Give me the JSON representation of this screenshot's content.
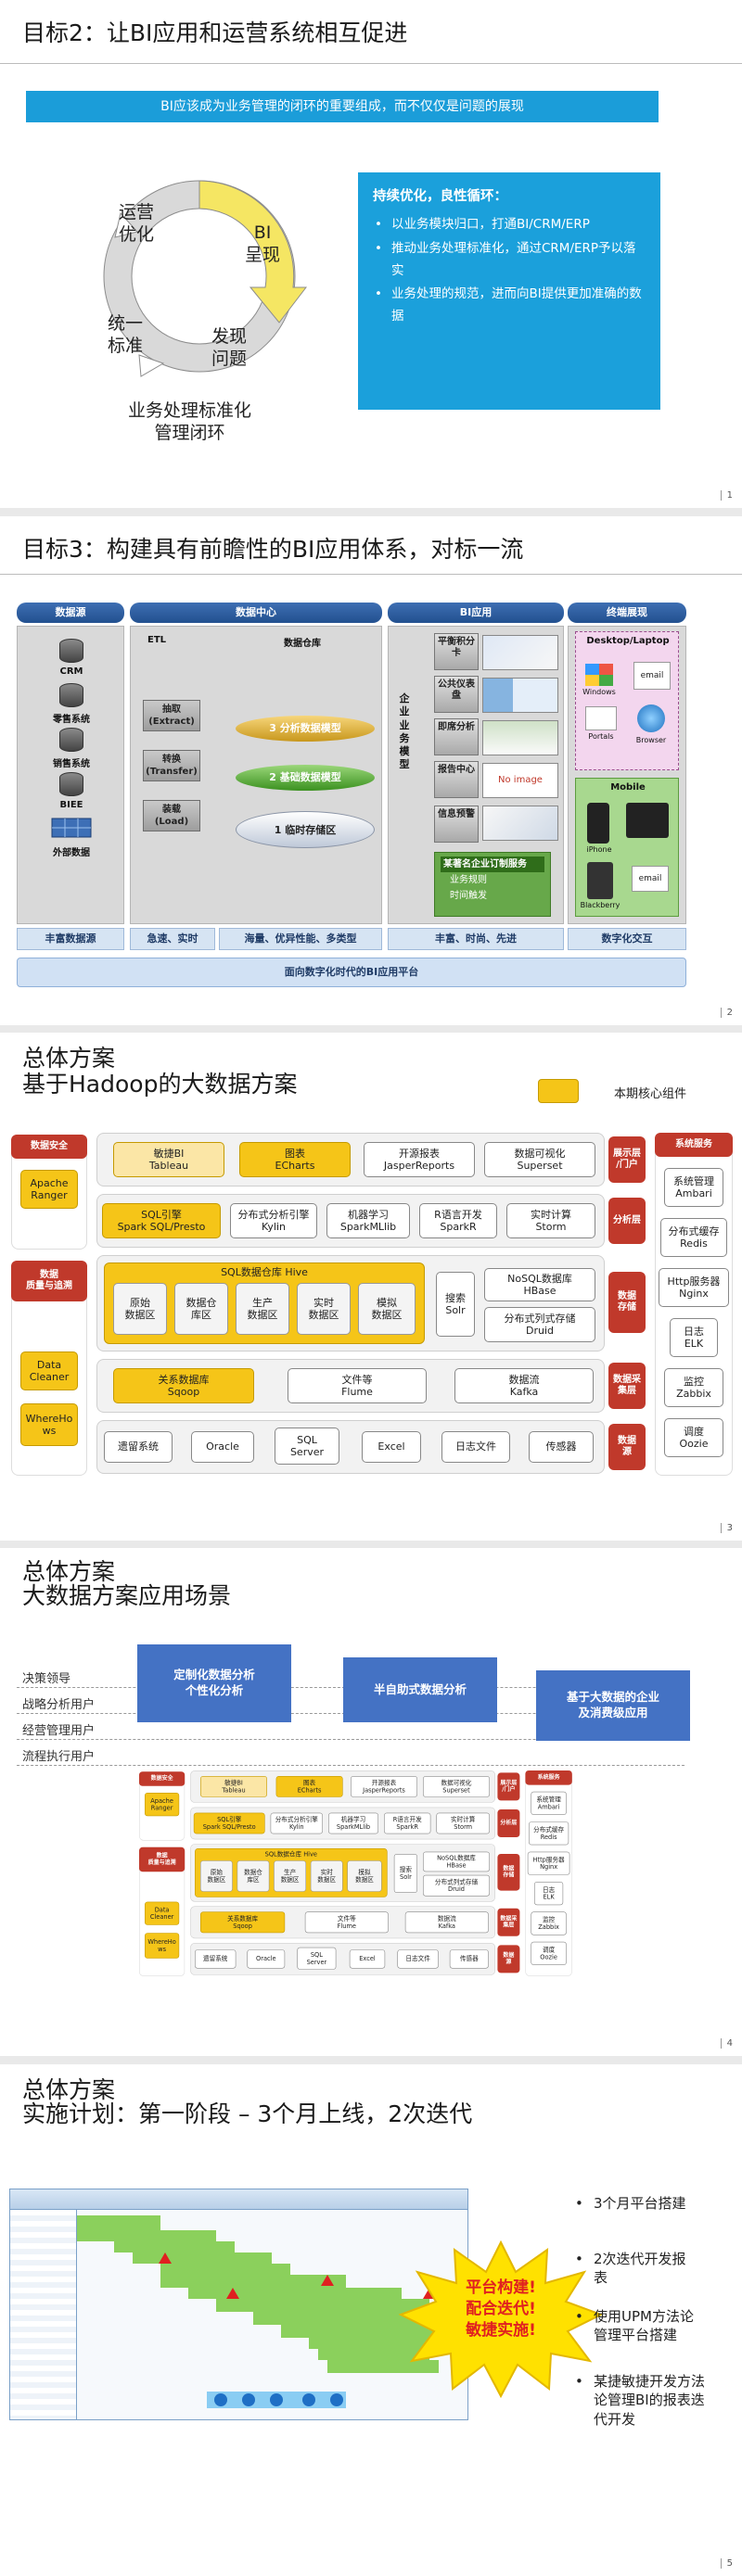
{
  "slide1": {
    "title": "目标2：让BI应用和运营系统相互促进",
    "banner": "BI应该成为业务管理的闭环的重要组成，而不仅仅是问题的展现",
    "cycle": {
      "ops": "运营\n优化",
      "bi": "BI\n呈现",
      "find": "发现\n问题",
      "std": "统一\n标准",
      "bottom": "业务处理标准化\n管理闭环"
    },
    "box": {
      "heading": "持续优化，良性循环：",
      "items": [
        "以业务模块归口，打通BI/CRM/ERP",
        "推动业务处理标准化，通过CRM/ERP予以落实",
        "业务处理的规范，进而向BI提供更加准确的数据"
      ]
    },
    "page": "1"
  },
  "slide2": {
    "title": "目标3：构建具有前瞻性的BI应用体系，对标一流",
    "heads": [
      "数据源",
      "数据中心",
      "BI应用",
      "终端展现"
    ],
    "sources": [
      "CRM",
      "零售系统",
      "销售系统",
      "BIEE",
      "外部数据"
    ],
    "etl_label": "ETL",
    "dw_label": "数据仓库",
    "etl": [
      "抽取\n(Extract)",
      "转换\n(Transfer)",
      "装载\n(Load)"
    ],
    "dw": [
      "分析数据模型",
      "基础数据模型",
      "临时存储区"
    ],
    "dw_nums": [
      "3",
      "2",
      "1"
    ],
    "bi_vertical": "企业业务模型",
    "bi_items": [
      "平衡积分卡",
      "公共仪表盘",
      "即席分析",
      "报告中心",
      "信息预警"
    ],
    "bi_noimage": "No image",
    "subscribe": {
      "title": "某著名企业订制服务",
      "lines": [
        "业务规则",
        "时间触发"
      ]
    },
    "terminals": {
      "desktop": "Desktop/Laptop",
      "mobile": "Mobile",
      "email": "email",
      "windows": "Windows",
      "portals": "Portals",
      "browser": "Browser",
      "iphone": "iPhone",
      "blackberry": "Blackberry"
    },
    "foots": [
      "丰富数据源",
      "急速、实时",
      "海量、优异性能、多类型",
      "丰富、时尚、先进",
      "数字化交互"
    ],
    "platform": "面向数字化时代的BI应用平台",
    "page": "2"
  },
  "slide3": {
    "title1": "总体方案",
    "title2": "基于Hadoop的大数据方案",
    "legend": "本期核心组件",
    "left": {
      "security": "数据安全",
      "ranger": "Apache\nRanger",
      "quality": "数据\n质量与追溯",
      "cleaner": "Data\nCleaner",
      "wherehows": "WhereHo\nws"
    },
    "rows": {
      "r1": [
        "敏捷BI\nTableau",
        "图表\nECharts",
        "开源报表\nJasperReports",
        "数据可视化\nSuperset"
      ],
      "r2": [
        "SQL引擎\nSpark SQL/Presto",
        "分布式分析引擎\nKylin",
        "机器学习\nSparkMLlib",
        "R语言开发\nSparkR",
        "实时计算\nStorm"
      ],
      "hive": "SQL数据仓库 Hive",
      "r3": [
        "原始\n数据区",
        "数据仓\n库区",
        "生产\n数据区",
        "实时\n数据区",
        "模拟\n数据区"
      ],
      "search": "搜索\nSolr",
      "nosql": "NoSQL数据库\nHBase",
      "druid": "分布式列式存储\nDruid",
      "r4": [
        "关系数据库\nSqoop",
        "文件等\nFlume",
        "数据流\nKafka"
      ],
      "r5": [
        "遗留系统",
        "Oracle",
        "SQL\nServer",
        "Excel",
        "日志文件",
        "传感器"
      ]
    },
    "right_tags": [
      "展示层\n/门户",
      "分析层",
      "数据\n存储",
      "数据采\n集层",
      "数据\n源"
    ],
    "services": {
      "head": "系统服务",
      "items": [
        "系统管理\nAmbari",
        "分布式缓存\nRedis",
        "Http服务器\nNginx",
        "日志\nELK",
        "监控\nZabbix",
        "调度\nOozie"
      ]
    },
    "page": "3"
  },
  "slide4": {
    "title1": "总体方案",
    "title2": "大数据方案应用场景",
    "users": [
      "决策领导",
      "战略分析用户",
      "经营管理用户",
      "流程执行用户"
    ],
    "callouts": [
      "定制化数据分析\n个性化分析",
      "半自助式数据分析",
      "基于大数据的企业\n及消费级应用"
    ],
    "page": "4"
  },
  "slide5": {
    "title1": "总体方案",
    "title2": "实施计划：第一阶段 – 3个月上线，2次迭代",
    "star": "平台构建!\n配合迭代!\n敏捷实施!",
    "bullets": [
      "3个月平台搭建",
      "2次迭代开发报表",
      "使用UPM方法论管理平台搭建",
      "某捷敏捷开发方法论管理BI的报表迭代开发"
    ],
    "page": "5"
  }
}
